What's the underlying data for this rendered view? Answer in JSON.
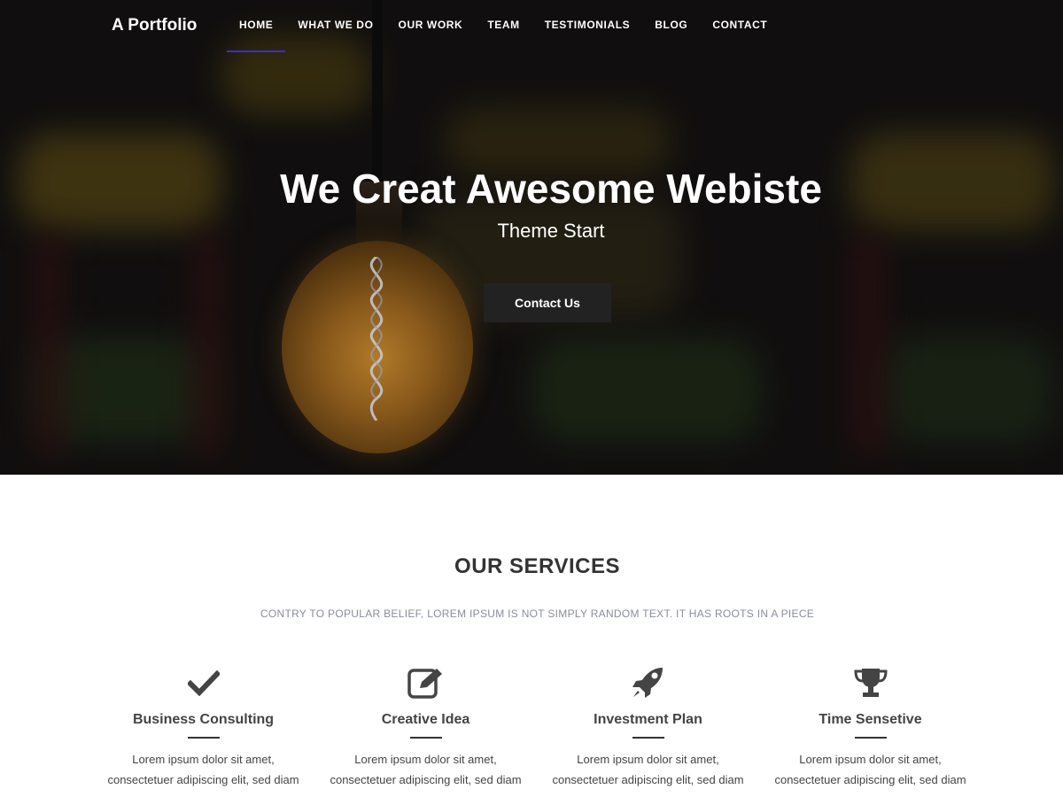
{
  "brand": "A Portfolio",
  "nav": {
    "items": [
      "HOME",
      "WHAT WE DO",
      "OUR WORK",
      "TEAM",
      "TESTIMONIALS",
      "BLOG",
      "CONTACT"
    ],
    "active": "HOME"
  },
  "hero": {
    "title": "We Creat Awesome Webiste",
    "subtitle": "Theme Start",
    "cta_label": "Contact Us"
  },
  "services": {
    "title": "OUR SERVICES",
    "subtitle": "CONTRY TO POPULAR BELIEF, LOREM IPSUM IS NOT SIMPLY RANDOM TEXT. IT HAS ROOTS IN A PIECE",
    "items": [
      {
        "icon": "check-icon",
        "title": "Business Consulting",
        "text1": "Lorem ipsum dolor sit amet,",
        "text2": "consectetuer adipiscing elit, sed diam"
      },
      {
        "icon": "edit-icon",
        "title": "Creative Idea",
        "text1": "Lorem ipsum dolor sit amet,",
        "text2": "consectetuer adipiscing elit, sed diam"
      },
      {
        "icon": "rocket-icon",
        "title": "Investment Plan",
        "text1": "Lorem ipsum dolor sit amet,",
        "text2": "consectetuer adipiscing elit, sed diam"
      },
      {
        "icon": "trophy-icon",
        "title": "Time Sensetive",
        "text1": "Lorem ipsum dolor sit amet,",
        "text2": "consectetuer adipiscing elit, sed diam"
      }
    ]
  },
  "colors": {
    "nav_active_underline": "#3a2ed0",
    "cta_background": "#222222",
    "icon_color": "#444444"
  }
}
